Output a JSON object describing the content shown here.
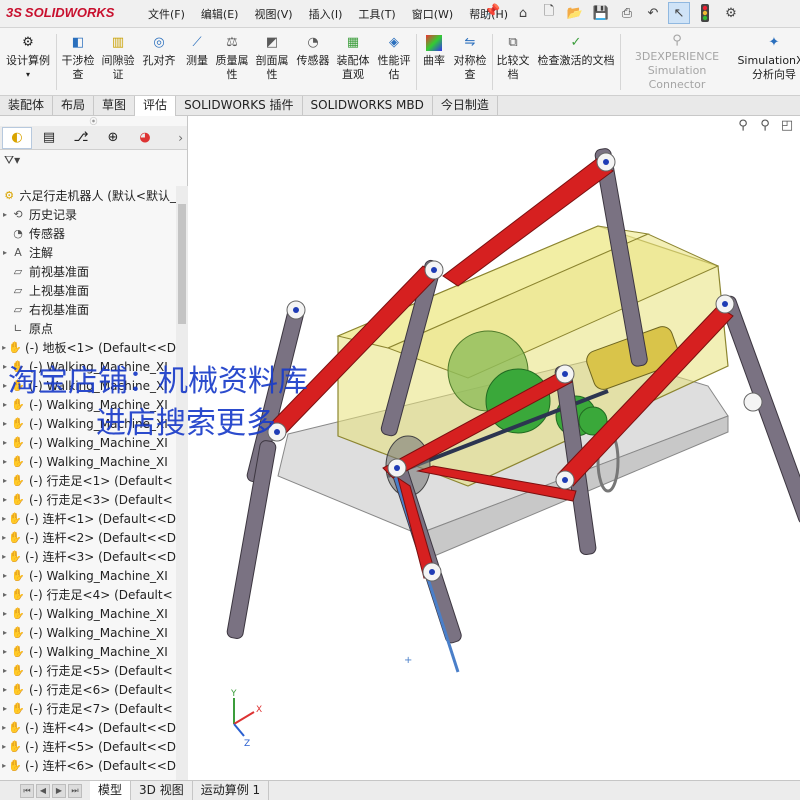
{
  "app": {
    "logo_ds": "3S",
    "logo_text": "SOLIDWORKS"
  },
  "menu": [
    "文件(F)",
    "编辑(E)",
    "视图(V)",
    "插入(I)",
    "工具(T)",
    "窗口(W)",
    "帮助(H)"
  ],
  "quick_access": [
    "home-icon",
    "new-icon",
    "open-icon",
    "save-icon",
    "print-icon",
    "undo-icon",
    "select-icon",
    "traffic-light-icon",
    "options-icon"
  ],
  "ribbon": {
    "design_study": "设计算例",
    "interference": "干涉检查",
    "clearance": "间隙验证",
    "hole_align": "孔对齐",
    "measure": "测量",
    "mass_props": "质量属性",
    "section_props": "剖面属性",
    "sensor": "传感器",
    "assembly_vis": "装配体直观",
    "performance": "性能评估",
    "curvature": "曲率",
    "symmetry": "对称检查",
    "compare": "比较文档",
    "check_active": "检查激活的文档",
    "experience_line1": "3DEXPERIENCE",
    "experience_line2": "Simulation Connector",
    "simxpress_line1": "SimulationXp",
    "simxpress_line2": "分析向导"
  },
  "tabs": [
    "装配体",
    "布局",
    "草图",
    "评估",
    "SOLIDWORKS 插件",
    "SOLIDWORKS MBD",
    "今日制造"
  ],
  "active_tab": "评估",
  "tree": {
    "root": "六足行走机器人 (默认<默认_",
    "items": [
      {
        "label": "历史记录",
        "icon": "history-icon",
        "exp": "▸"
      },
      {
        "label": "传感器",
        "icon": "sensor-icon",
        "exp": ""
      },
      {
        "label": "注解",
        "icon": "annotation-icon",
        "exp": "▸"
      },
      {
        "label": "前视基准面",
        "icon": "plane-icon",
        "exp": ""
      },
      {
        "label": "上视基准面",
        "icon": "plane-icon",
        "exp": ""
      },
      {
        "label": "右视基准面",
        "icon": "plane-icon",
        "exp": ""
      },
      {
        "label": "原点",
        "icon": "origin-icon",
        "exp": ""
      },
      {
        "label": "(-) 地板<1> (Default<<D",
        "icon": "part-icon",
        "exp": "▸"
      },
      {
        "label": "(-) Walking_Machine_XI",
        "icon": "part-icon",
        "exp": "▸"
      },
      {
        "label": "(-) Walking_Machine_XI",
        "icon": "part-icon",
        "exp": "▸"
      },
      {
        "label": "(-) Walking_Machine_XI",
        "icon": "part-icon",
        "exp": "▸"
      },
      {
        "label": "(-) Walking_Machine_XI",
        "icon": "part-icon",
        "exp": "▸"
      },
      {
        "label": "(-) Walking_Machine_XI",
        "icon": "part-icon",
        "exp": "▸"
      },
      {
        "label": "(-) Walking_Machine_XI",
        "icon": "part-icon",
        "exp": "▸"
      },
      {
        "label": "(-) 行走足<1> (Default<",
        "icon": "part-icon",
        "exp": "▸"
      },
      {
        "label": "(-) 行走足<3> (Default<",
        "icon": "part-icon",
        "exp": "▸"
      },
      {
        "label": "(-) 连杆<1> (Default<<D",
        "icon": "part-icon",
        "exp": "▸"
      },
      {
        "label": "(-) 连杆<2> (Default<<D",
        "icon": "part-icon",
        "exp": "▸"
      },
      {
        "label": "(-) 连杆<3> (Default<<D",
        "icon": "part-icon",
        "exp": "▸"
      },
      {
        "label": "(-) Walking_Machine_XI",
        "icon": "part-icon",
        "exp": "▸"
      },
      {
        "label": "(-) 行走足<4> (Default<",
        "icon": "part-icon",
        "exp": "▸"
      },
      {
        "label": "(-) Walking_Machine_XI",
        "icon": "part-icon",
        "exp": "▸"
      },
      {
        "label": "(-) Walking_Machine_XI",
        "icon": "part-icon",
        "exp": "▸"
      },
      {
        "label": "(-) Walking_Machine_XI",
        "icon": "part-icon",
        "exp": "▸"
      },
      {
        "label": "(-) 行走足<5> (Default<",
        "icon": "part-icon",
        "exp": "▸"
      },
      {
        "label": "(-) 行走足<6> (Default<",
        "icon": "part-icon",
        "exp": "▸"
      },
      {
        "label": "(-) 行走足<7> (Default<",
        "icon": "part-icon",
        "exp": "▸"
      },
      {
        "label": "(-) 连杆<4> (Default<<D",
        "icon": "part-icon",
        "exp": "▸"
      },
      {
        "label": "(-) 连杆<5> (Default<<D",
        "icon": "part-icon",
        "exp": "▸"
      },
      {
        "label": "(-) 连杆<6> (Default<<D",
        "icon": "part-icon",
        "exp": "▸"
      }
    ]
  },
  "bottom_tabs": [
    "模型",
    "3D 视图",
    "运动算例 1"
  ],
  "active_bottom_tab": "模型",
  "watermark": {
    "line1": "淘宝店铺：机械资料库",
    "line2": "进店搜索更多"
  },
  "triad": {
    "x": "X",
    "y": "Y",
    "z": "Z"
  },
  "colors": {
    "housing": "#e8e27a",
    "link_red": "#d62020",
    "leg_gray": "#7a7282",
    "watermark_blue": "#1a3cc9"
  }
}
